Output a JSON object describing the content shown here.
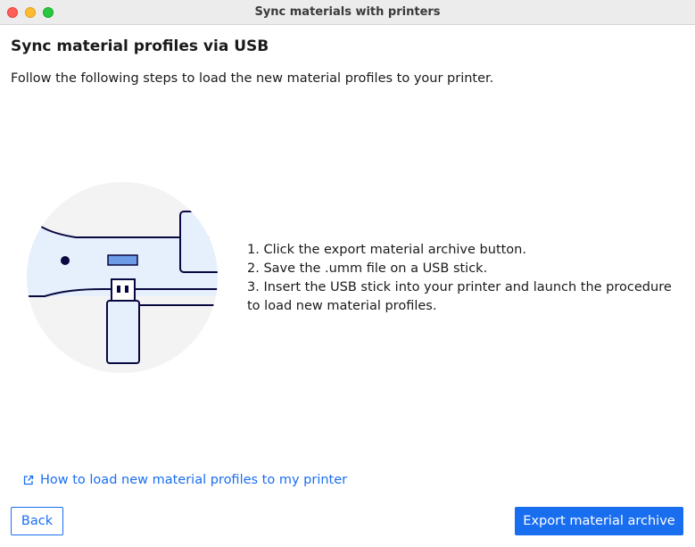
{
  "window": {
    "title": "Sync materials with printers"
  },
  "page": {
    "heading": "Sync material profiles via USB",
    "subtitle": "Follow the following steps to load the new material profiles to your printer."
  },
  "steps": [
    "1. Click the export material archive button.",
    "2. Save the .umm file on a USB stick.",
    "3. Insert the USB stick into your printer and launch the procedure to load new material profiles."
  ],
  "help_link": {
    "label": "How to load new material profiles to my printer",
    "icon": "external-link-icon"
  },
  "buttons": {
    "back_label": "Back",
    "export_label": "Export material archive"
  },
  "colors": {
    "accent": "#196ef0",
    "illustration_navy": "#08073f",
    "illustration_light": "#e6f0fc",
    "illustration_bg": "#f3f3f3"
  }
}
